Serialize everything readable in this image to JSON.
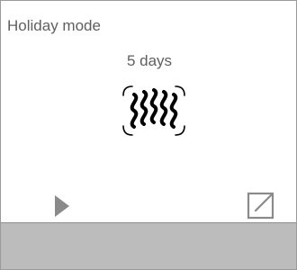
{
  "screen": {
    "title": "Holiday mode",
    "duration": "5 days"
  },
  "icons": {
    "heating": "heating-waves-icon",
    "play": "play-icon",
    "edit": "edit-icon"
  },
  "colors": {
    "text": "#5f5f5f",
    "icon": "#000000",
    "control": "#8a8a8a",
    "bottom_bar": "#bcbcbc"
  }
}
